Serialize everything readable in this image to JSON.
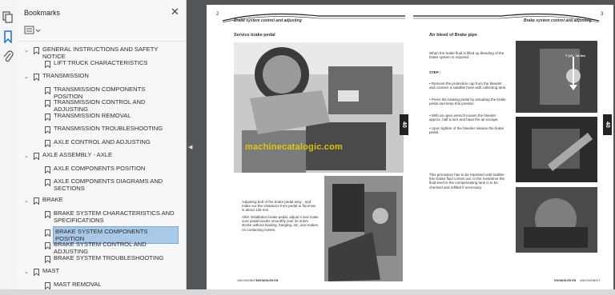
{
  "sidebar_tools": [
    "pages-icon",
    "bookmark-icon",
    "attachment-icon"
  ],
  "bookmarks": {
    "title": "Bookmarks",
    "items": [
      {
        "label": "GENERAL INSTRUCTIONS AND SAFETY NOTICE",
        "level": 0,
        "expanded": true
      },
      {
        "label": "LIFT TRUCK CHARACTERISTICS",
        "level": 1
      },
      {
        "label": "TRANSMISSION",
        "level": 0,
        "expanded": true
      },
      {
        "label": "TRANSMISSION COMPONENTS POSITION",
        "level": 1
      },
      {
        "label": "TRANSMISSION CONTROL AND ADJUSTING",
        "level": 1
      },
      {
        "label": "TRANSMISSION REMOVAL",
        "level": 1
      },
      {
        "label": "TRANSMISSION TROUBLESHOOTING",
        "level": 1
      },
      {
        "label": "AXLE CONTROL AND ADJUSTING",
        "level": 1
      },
      {
        "label": "AXLE ASSEMBLY - AXLE",
        "level": 0,
        "expanded": true
      },
      {
        "label": "AXLE COMPONENTS POSITION",
        "level": 1
      },
      {
        "label": "AXLE COMPONENTS DIAGRAMS AND SECTIONS",
        "level": 1
      },
      {
        "label": "BRAKE",
        "level": 0,
        "expanded": true
      },
      {
        "label": "BRAKE SYSTEM CHARACTERISTICS AND SPECIFICATIONS",
        "level": 1
      },
      {
        "label": "BRAKE SYSTEM COMPONENTS POSITION",
        "level": 1,
        "selected": true
      },
      {
        "label": "BRAKE SYSTEM CONTROL AND ADJUSTING",
        "level": 1
      },
      {
        "label": "BRAKE SYSTEM TROUBLESHOOTING",
        "level": 1
      },
      {
        "label": "MAST",
        "level": 0,
        "expanded": true
      },
      {
        "label": "MAST REMOVAL",
        "level": 1
      }
    ]
  },
  "left_page": {
    "page_number": "2",
    "header": "Brake system control and adjusting",
    "section_title": "Service brake pedal",
    "tab": "40",
    "watermark": "machinecatalogic.com",
    "body_text": "Adjusting bolt of the brake pedal assy , and make sur the clearance from pedal to floormat is about 125 mm.",
    "body_text2": "After installation brake pedal, adjust it and make sure pedal travels smoothly over its entire stroke without binding, hanging, etc, and makes no contacting noises.",
    "footer_left": "4061/0/UNNN71",
    "footer_right": "HOHANN-EN EN"
  },
  "right_page": {
    "page_number": "3",
    "header": "Brake system control and adjusting",
    "section_title": "Air bleed of Brake pipe",
    "tab": "40",
    "intro": "When the brake fluid is filled up bleeding of the brake system is required :",
    "step_label": "STEP :",
    "steps": [
      "• Remove the protection cap from the bleeder and connect a suitable hose with collecting tank.",
      "• Press the braking pedal by actuating the brake pedal and keep this position",
      "• With an open wrench loosen the bleeder approx. half a turn and have the air escape.",
      "• Upon tighten of the bleeder release the brake pedal."
    ],
    "closing": "This procedure has to be repeated until bubble-free brake fluid comes out. In the meantime the fluid level in the compensating tank is to be checked and refilled if necessary.",
    "torque_label": "T (12 - 18 Nm",
    "footer_left": "HOHANN-EN EN",
    "footer_right": "4061/0/UNNN71"
  }
}
